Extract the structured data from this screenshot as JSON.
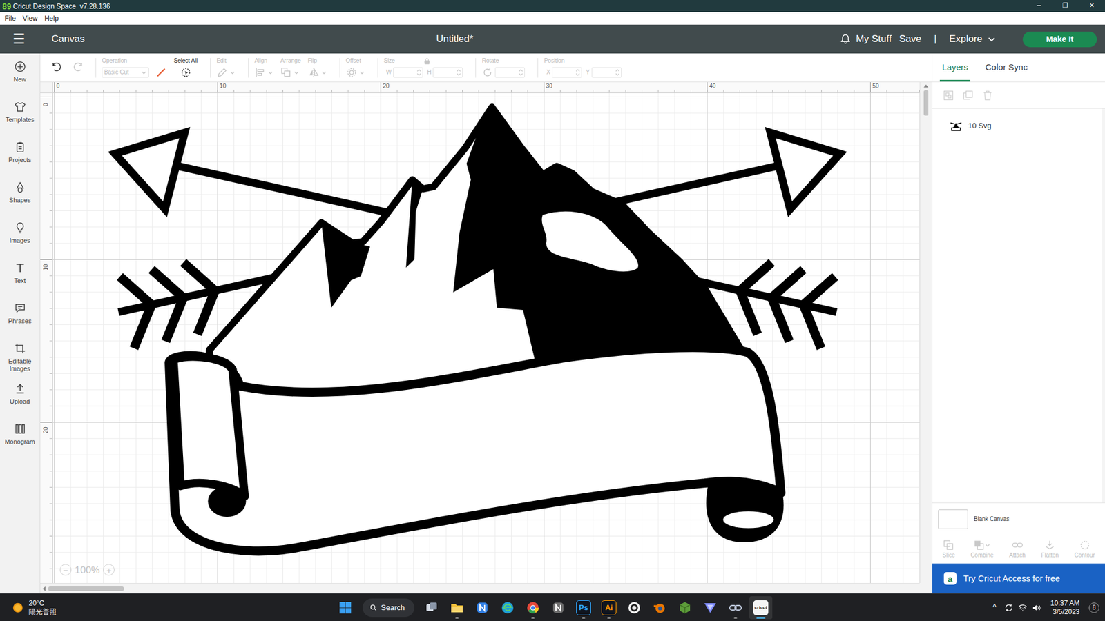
{
  "window": {
    "title": "Cricut Design Space  v7.28.136",
    "fps": "89",
    "controls": [
      "─",
      "❐",
      "✕"
    ]
  },
  "menu": [
    "File",
    "View",
    "Help"
  ],
  "header": {
    "menu_icon": "☰",
    "section": "Canvas",
    "document": "Untitled*",
    "links": [
      "My Stuff",
      "Save"
    ],
    "divider": "|",
    "explore": "Explore",
    "action": "Make It"
  },
  "toolbar": {
    "undo": {
      "disabled": false
    },
    "redo": {
      "disabled": true
    },
    "groups": [
      {
        "label": "Operation",
        "kind": "select",
        "value": "Basic Cut",
        "disabled": true
      },
      {
        "label": "Select All",
        "kind": "button",
        "disabled": false
      },
      {
        "label": "Edit",
        "kind": "dropdown",
        "disabled": true
      },
      {
        "label": "Align",
        "kind": "dropdown",
        "disabled": true
      },
      {
        "label": "Arrange",
        "kind": "dropdown",
        "disabled": true
      },
      {
        "label": "Flip",
        "kind": "dropdown",
        "disabled": true
      },
      {
        "label": "Offset",
        "kind": "dropdown",
        "disabled": true
      },
      {
        "label": "Size",
        "kind": "fields",
        "fields": [
          "W",
          "H"
        ],
        "locked": true,
        "disabled": true
      },
      {
        "label": "Rotate",
        "kind": "rotate",
        "disabled": true
      },
      {
        "label": "Position",
        "kind": "fields",
        "fields": [
          "X",
          "Y"
        ],
        "disabled": true
      }
    ]
  },
  "sidebar": {
    "items": [
      "New",
      "Templates",
      "Projects",
      "Shapes",
      "Images",
      "Text",
      "Phrases",
      "Editable Images",
      "Upload",
      "Monogram"
    ]
  },
  "canvas": {
    "ruler_top": [
      "0",
      "10",
      "20",
      "30",
      "40",
      "50"
    ],
    "ruler_left": [
      "0",
      "10",
      "20"
    ],
    "zoom": {
      "out": "−",
      "value": "100%",
      "in": "+",
      "disabled": true
    },
    "scroll": {
      "vertical": {
        "level": 0.05
      },
      "horizontal": {
        "level": 0.086
      }
    }
  },
  "layers_panel": {
    "tabs": [
      {
        "label": "Layers",
        "selected": true
      },
      {
        "label": "Color Sync",
        "selected": false
      }
    ],
    "actions": [
      {
        "disabled": true
      },
      {
        "disabled": true
      },
      {
        "disabled": true
      }
    ],
    "layers": [
      {
        "name": "10 Svg",
        "selected": false
      }
    ],
    "background": "Blank Canvas",
    "tools": [
      {
        "label": "Slice",
        "disabled": true
      },
      {
        "label": "Combine",
        "disabled": true
      },
      {
        "label": "Attach",
        "disabled": true
      },
      {
        "label": "Flatten",
        "disabled": true
      },
      {
        "label": "Contour",
        "disabled": true
      }
    ],
    "promo": {
      "icon": "a",
      "text": "Try Cricut Access for free"
    }
  },
  "taskbar": {
    "weather": {
      "temp": "20°C",
      "condition": "陽光普照"
    },
    "search": "Search",
    "apps": [
      {
        "kind": "taskview",
        "color": "#d7dee8",
        "running": false,
        "active": false
      },
      {
        "kind": "folder",
        "color": "#f3c13a",
        "running": true,
        "active": false
      },
      {
        "kind": "app",
        "color": "#2f7de1",
        "running": false,
        "active": false
      },
      {
        "kind": "edge",
        "color": "#1fa0d6",
        "running": false,
        "active": false
      },
      {
        "kind": "chrome",
        "color": "#e5483a",
        "running": true,
        "active": false
      },
      {
        "kind": "app",
        "color": "#6b6b6b",
        "running": false,
        "active": false
      },
      {
        "kind": "text",
        "glyph": "Ps",
        "color": "#31a8ff",
        "running": true,
        "active": false
      },
      {
        "kind": "text",
        "glyph": "Ai",
        "color": "#ff9a00",
        "running": true,
        "active": false
      },
      {
        "kind": "circle",
        "color": "#f2f2f2",
        "running": false,
        "active": false
      },
      {
        "kind": "blender",
        "color": "#ea7600",
        "running": false,
        "active": false
      },
      {
        "kind": "cube",
        "color": "#5d9c3a",
        "running": false,
        "active": false
      },
      {
        "kind": "triangle",
        "color": "#7f8cff",
        "running": false,
        "active": false
      },
      {
        "kind": "link",
        "color": "#b9c3d6",
        "running": true,
        "active": false
      },
      {
        "kind": "tile",
        "glyph": "cricut",
        "color": "#f5f5f5",
        "running": true,
        "active": true
      }
    ],
    "tray": {
      "chevron": "^",
      "time": "10:37 AM",
      "date": "3/5/2023",
      "badge": "8"
    }
  }
}
